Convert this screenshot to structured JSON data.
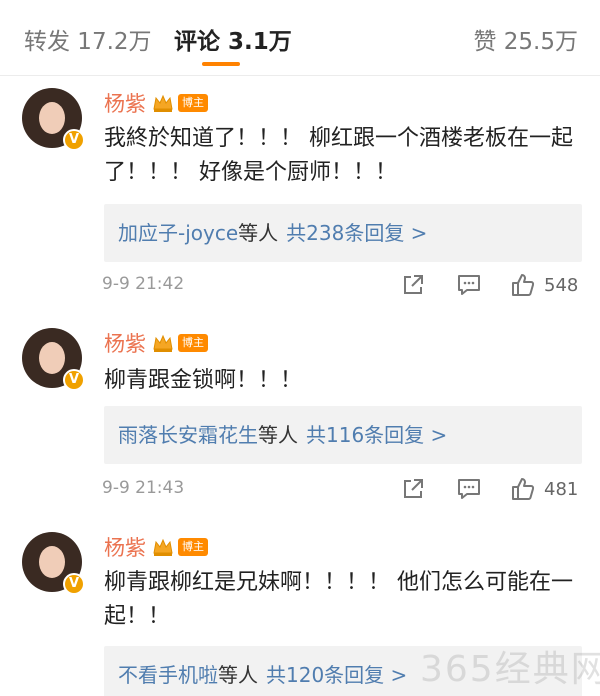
{
  "tabs": {
    "repost": "转发 17.2万",
    "comments": "评论 3.1万",
    "likes": "赞 25.5万"
  },
  "badge_label": "博主",
  "comments": [
    {
      "name": "杨紫",
      "text": "我終於知道了！！！ 柳红跟一个酒楼老板在一起了！！！ 好像是个厨师！！！",
      "reply_names": "加应子-joyce",
      "reply_suffix": "等人",
      "reply_count": "共238条回复 >",
      "time": "9-9 21:42",
      "likes": "548"
    },
    {
      "name": "杨紫",
      "text": "柳青跟金锁啊！！！",
      "reply_names": "雨落长安霜花生",
      "reply_suffix": "等人",
      "reply_count": "共116条回复 >",
      "time": "9-9 21:43",
      "likes": "481"
    },
    {
      "name": "杨紫",
      "text": "柳青跟柳红是兄妹啊！！！！ 他们怎么可能在一起！！",
      "reply_names": "不看手机啦",
      "reply_suffix": "等人",
      "reply_count": "共120条回复 >",
      "time": "",
      "likes": ""
    }
  ],
  "watermark": "365经典网",
  "colors": {
    "accent": "#ff8200",
    "name": "#eb7350",
    "link": "#507daf"
  },
  "icons": [
    "crown-icon",
    "verified-v-icon",
    "share-icon",
    "comment-icon",
    "thumbs-up-icon"
  ]
}
